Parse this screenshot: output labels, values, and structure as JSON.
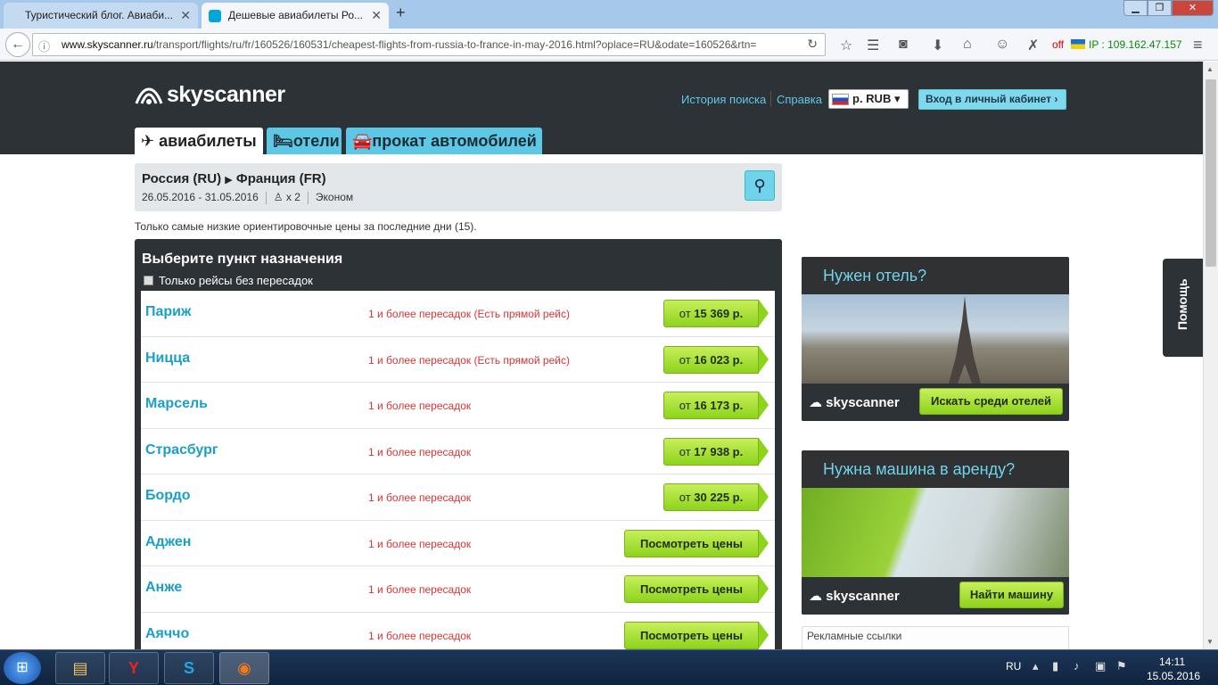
{
  "browser": {
    "tabs": [
      {
        "label": "Туристический блог. Авиаби..."
      },
      {
        "label": "Дешевые авиабилеты Ро..."
      }
    ],
    "url_domain": "www.skyscanner.ru",
    "url_path": "/transport/flights/ru/fr/160526/160531/cheapest-flights-from-russia-to-france-in-may-2016.html?oplace=RU&odate=160526&rtn=",
    "off_label": "off",
    "ip_label": "IP : 109.162.47.157"
  },
  "header": {
    "logo_text": "skyscanner",
    "history_link": "История поиска",
    "help_link": "Справка",
    "currency": "р. RUB",
    "login_button": "Вход в личный кабинет",
    "tabs": {
      "flights": "авиабилеты",
      "hotels": "отели",
      "cars": "прокат автомобилей"
    }
  },
  "summary": {
    "route_from": "Россия (RU)",
    "route_to": "Франция (FR)",
    "dates": "26.05.2016 - 31.05.2016",
    "passengers": "x 2",
    "cabin": "Эконом"
  },
  "notice": "Только самые низкие ориентировочные цены за последние дни (15).",
  "destinations": {
    "title": "Выберите пункт назначения",
    "direct_only_label": "Только рейсы без пересадок",
    "rows": [
      {
        "name": "Париж",
        "info": "1 и более пересадок (Есть прямой рейс)",
        "price_prefix": "от",
        "price": "15 369 р."
      },
      {
        "name": "Ницца",
        "info": "1 и более пересадок (Есть прямой рейс)",
        "price_prefix": "от",
        "price": "16 023 р."
      },
      {
        "name": "Марсель",
        "info": "1 и более пересадок",
        "price_prefix": "от",
        "price": "16 173 р."
      },
      {
        "name": "Страсбург",
        "info": "1 и более пересадок",
        "price_prefix": "от",
        "price": "17 938 р."
      },
      {
        "name": "Бордо",
        "info": "1 и более пересадок",
        "price_prefix": "от",
        "price": "30 225 р."
      },
      {
        "name": "Аджен",
        "info": "1 и более пересадок",
        "view_label": "Посмотреть цены"
      },
      {
        "name": "Анже",
        "info": "1 и более пересадок",
        "view_label": "Посмотреть цены"
      },
      {
        "name": "Аяччо",
        "info": "1 и более пересадок",
        "view_label": "Посмотреть цены"
      }
    ]
  },
  "ads": {
    "hotel_title": "Нужен отель?",
    "hotel_button": "Искать среди отелей",
    "car_title": "Нужна машина в аренду?",
    "car_button": "Найти машину",
    "logo_text": "skyscanner",
    "links_label": "Рекламные ссылки"
  },
  "help_tab": "Помощь",
  "taskbar": {
    "lang": "RU",
    "time": "14:11",
    "date": "15.05.2016"
  },
  "colors": {
    "header_bg": "#2d3236",
    "accent": "#5dc8e6",
    "price_green": "#8ed31c",
    "destination_link": "#1a9fc9",
    "info_red": "#dd3333"
  }
}
